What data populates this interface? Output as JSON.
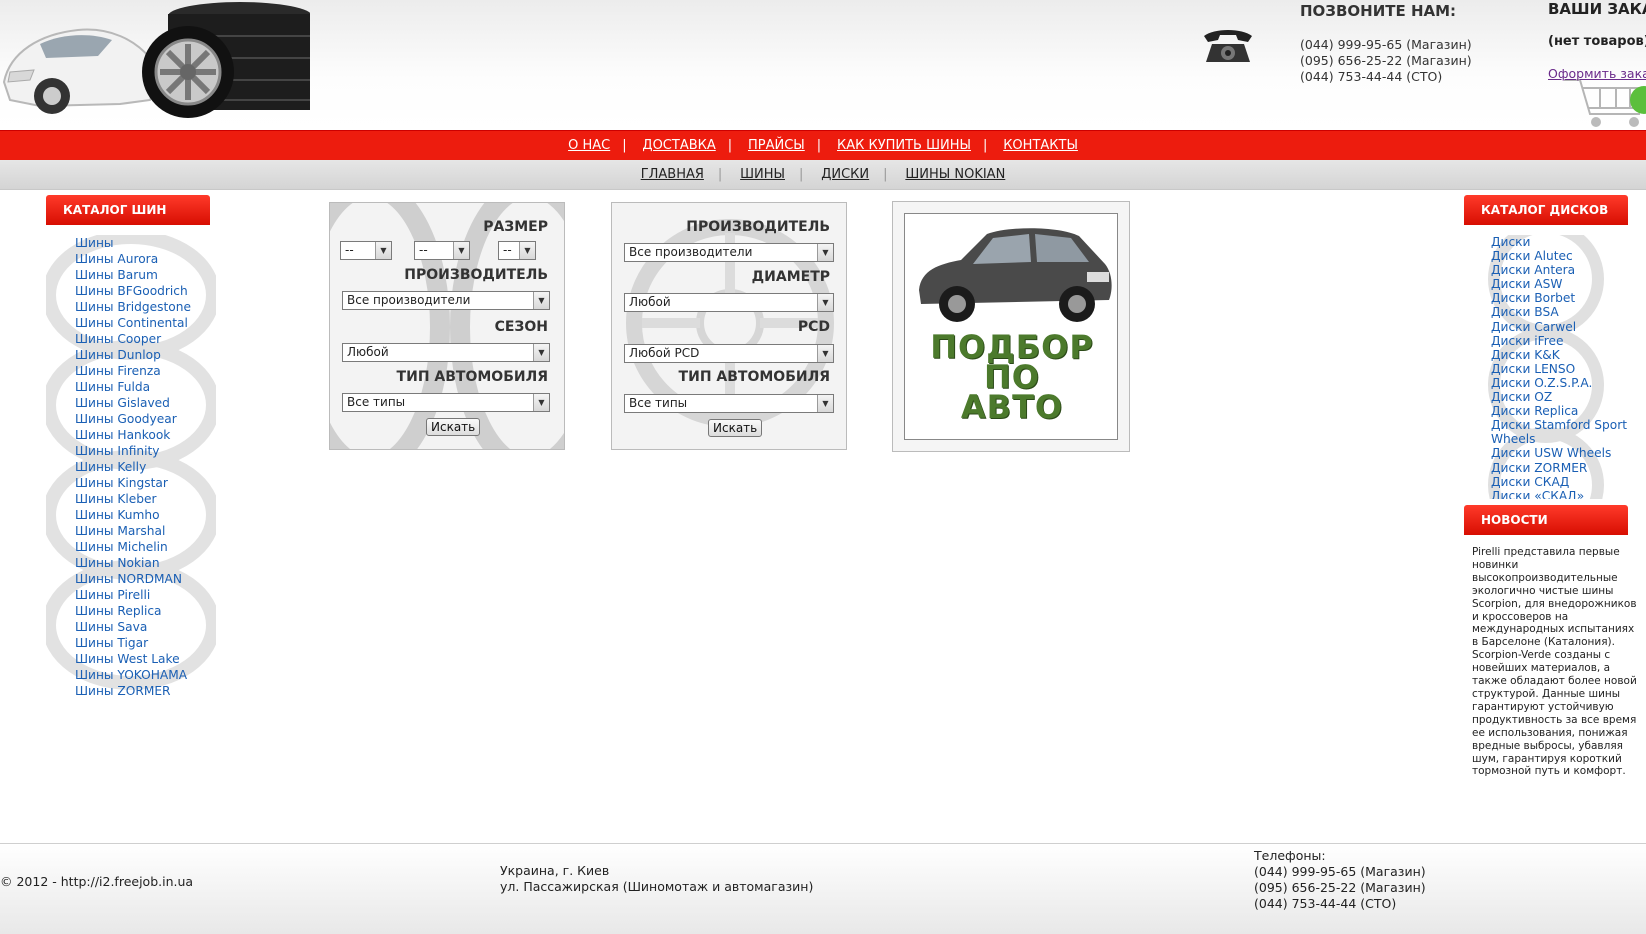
{
  "header": {
    "call_title": "ПОЗВОНИТЕ НАМ:",
    "phones": [
      "(044) 999-95-65 (Магазин)",
      "(095) 656-25-22 (Магазин)",
      "(044) 753-44-44 (СТО)"
    ],
    "cart_title": "ВАШИ ЗАКАЗ",
    "cart_empty": "(нет товаров)",
    "cart_link": "Оформить заказ"
  },
  "main_nav": [
    "О НАС",
    "ДОСТАВКА",
    "ПРАЙСЫ",
    "КАК КУПИТЬ ШИНЫ",
    "КОНТАКТЫ"
  ],
  "sub_nav": [
    "ГЛАВНАЯ",
    "ШИНЫ",
    "ДИСКИ",
    "ШИНЫ NOKIAN"
  ],
  "tire_catalog": {
    "title": "КАТАЛОГ ШИН",
    "items": [
      "Шины",
      "Шины Aurora",
      "Шины Barum",
      "Шины BFGoodrich",
      "Шины Bridgestone",
      "Шины Continental",
      "Шины Cooper",
      "Шины Dunlop",
      "Шины Firenza",
      "Шины Fulda",
      "Шины Gislaved",
      "Шины Goodyear",
      "Шины Hankook",
      "Шины Infinity",
      "Шины Kelly",
      "Шины Kingstar",
      "Шины Kleber",
      "Шины Kumho",
      "Шины Marshal",
      "Шины Michelin",
      "Шины Nokian",
      "Шины NORDMAN",
      "Шины Pirelli",
      "Шины Replica",
      "Шины Sava",
      "Шины Tigar",
      "Шины West Lake",
      "Шины YOKOHAMA",
      "Шины ZORMER"
    ]
  },
  "wheel_catalog": {
    "title": "КАТАЛОГ ДИСКОВ",
    "items": [
      "Диски",
      "Диски Alutec",
      "Диски Antera",
      "Диски ASW",
      "Диски Borbet",
      "Диски BSA",
      "Диски Carwel",
      "Диски iFree",
      "Диски K&K",
      "Диски LENSO",
      "Диски O.Z.S.P.A.",
      "Диски OZ",
      "Диски Replica",
      "Диски Stamford Sport Wheels",
      "Диски USW Wheels",
      "Диски ZORMER",
      "Диски СКАД",
      "Диски «СКАД»"
    ]
  },
  "tire_search": {
    "size_label": "РАЗМЕР",
    "size_values": [
      "--",
      "--",
      "--"
    ],
    "manufacturer_label": "ПРОИЗВОДИТЕЛЬ",
    "manufacturer_value": "Все производители",
    "season_label": "СЕЗОН",
    "season_value": "Любой",
    "car_type_label": "ТИП АВТОМОБИЛЯ",
    "car_type_value": "Все типы",
    "search_button": "Искать"
  },
  "wheel_search": {
    "manufacturer_label": "ПРОИЗВОДИТЕЛЬ",
    "manufacturer_value": "Все производители",
    "diameter_label": "ДИАМЕТР",
    "diameter_value": "Любой",
    "pcd_label": "PCD",
    "pcd_value": "Любой PCD",
    "car_type_label": "ТИП АВТОМОБИЛЯ",
    "car_type_value": "Все типы",
    "search_button": "Искать"
  },
  "auto_select": {
    "lines": [
      "ПОДБОР",
      "ПО",
      "АВТО"
    ]
  },
  "news": {
    "title": "НОВОСТИ",
    "text": "Pirelli представила первые новинки высокопроизводительные экологично чистые шины Scorpion, для внедорожников и кроссоверов на международных испытаниях в Барселоне (Каталония). Scorpion-Verde созданы с новейших материалов, а также обладают более новой структурой. Данные шины гарантируют устойчивую продуктивность за все время ее использования, понижая вредные выбросы, убавляя шум, гарантируя короткий тормозной путь и комфорт."
  },
  "footer": {
    "copyright": "© 2012 - http://i2.freejob.in.ua",
    "address_lines": [
      "Украина, г. Киев",
      "ул. Пассажирская (Шиномотаж и автомагазин)"
    ],
    "phones_title": "Телефоны:",
    "phones": [
      "(044) 999-95-65 (Магазин)",
      "(095) 656-25-22 (Магазин)",
      "(044) 753-44-44 (СТО)"
    ]
  },
  "colors": {
    "red_bar": "#ed1c0e",
    "link": "#1a5fb4",
    "auto_text": "#4c7a2c"
  }
}
